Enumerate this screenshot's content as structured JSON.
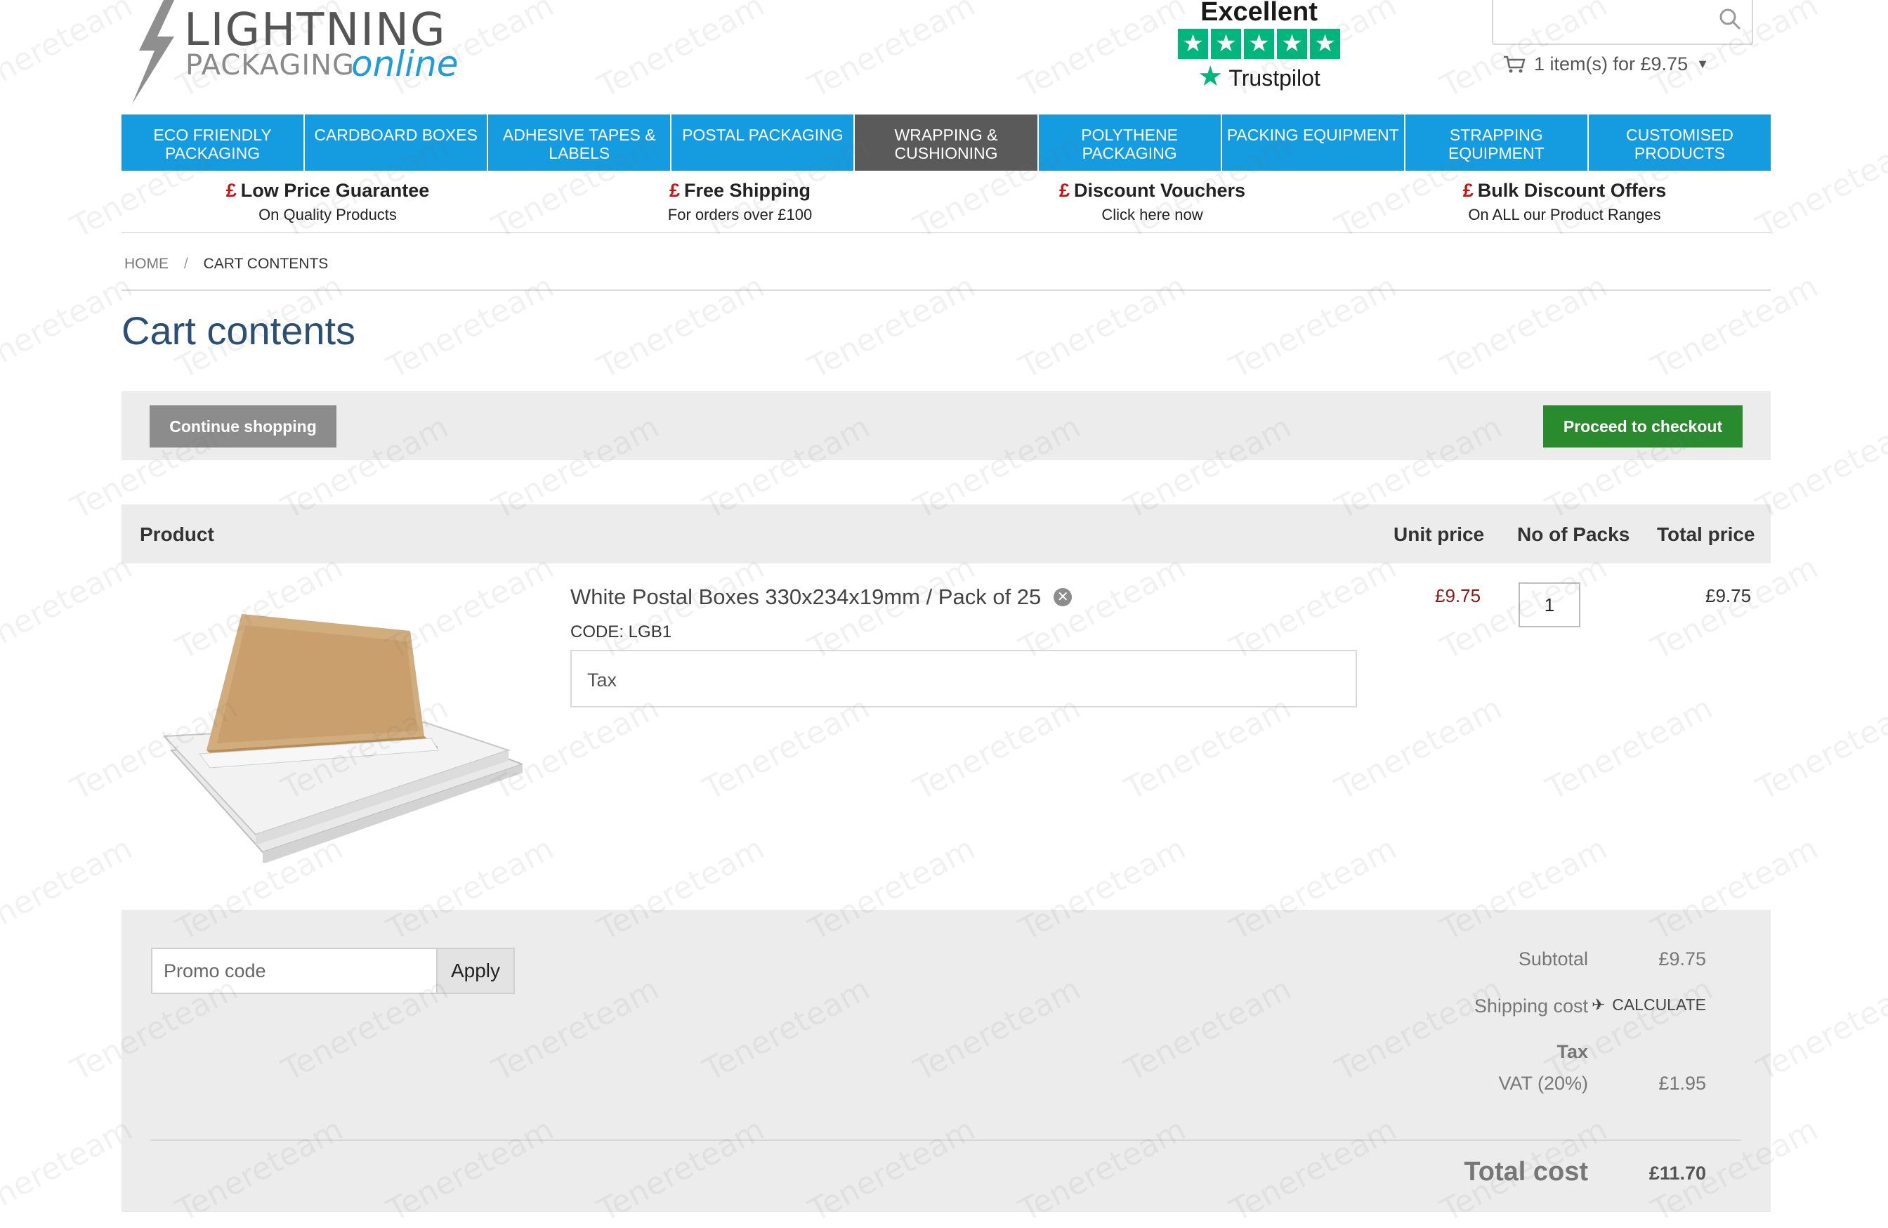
{
  "header": {
    "logo": {
      "line1": "LIGHTNING",
      "line2": "PACKAGING",
      "line3": "online"
    },
    "trustpilot": {
      "rating_label": "Excellent",
      "brand": "Trustpilot",
      "stars": 5
    },
    "search": {
      "placeholder": ""
    },
    "cart_summary": "1 item(s) for £9.75"
  },
  "nav": {
    "items": [
      {
        "label": "ECO FRIENDLY PACKAGING"
      },
      {
        "label": "CARDBOARD BOXES"
      },
      {
        "label": "ADHESIVE TAPES & LABELS"
      },
      {
        "label": "POSTAL PACKAGING"
      },
      {
        "label": "WRAPPING & CUSHIONING",
        "active": true
      },
      {
        "label": "POLYTHENE PACKAGING"
      },
      {
        "label": "PACKING EQUIPMENT"
      },
      {
        "label": "STRAPPING EQUIPMENT"
      },
      {
        "label": "CUSTOMISED PRODUCTS"
      }
    ]
  },
  "usp": [
    {
      "symbol": "£",
      "title": "Low Price Guarantee",
      "sub": "On Quality Products"
    },
    {
      "symbol": "£",
      "title": "Free Shipping",
      "sub": "For orders over £100"
    },
    {
      "symbol": "£",
      "title": "Discount Vouchers",
      "sub": "Click here now"
    },
    {
      "symbol": "£",
      "title": "Bulk Discount Offers",
      "sub": "On ALL our Product Ranges"
    }
  ],
  "breadcrumb": {
    "home": "HOME",
    "separator": "/",
    "current": "CART CONTENTS"
  },
  "page_title": "Cart contents",
  "actions": {
    "continue": "Continue shopping",
    "checkout": "Proceed to checkout"
  },
  "table": {
    "headers": {
      "product": "Product",
      "unit_price": "Unit price",
      "packs": "No of Packs",
      "total": "Total price"
    },
    "rows": [
      {
        "name": "White Postal Boxes 330x234x19mm / Pack of 25",
        "code": "CODE: LGB1",
        "tax_label": "Tax",
        "unit_price": "£9.75",
        "quantity": "1",
        "total_price": "£9.75"
      }
    ]
  },
  "totals": {
    "promo_placeholder": "Promo code",
    "apply": "Apply",
    "subtotal_label": "Subtotal",
    "subtotal": "£9.75",
    "shipping_label": "Shipping cost",
    "shipping_action": "CALCULATE",
    "tax_heading": "Tax",
    "vat_label": "VAT (20%)",
    "vat": "£1.95",
    "total_label": "Total cost",
    "total": "£11.70"
  },
  "watermark": "Tenereteam",
  "colors": {
    "nav_blue": "#149be0",
    "nav_active": "#5a5a5a",
    "checkout_green": "#2a8b2e",
    "price_red": "#8b1a1a",
    "title_blue": "#2b4e73",
    "trustpilot_green": "#00b67a"
  }
}
